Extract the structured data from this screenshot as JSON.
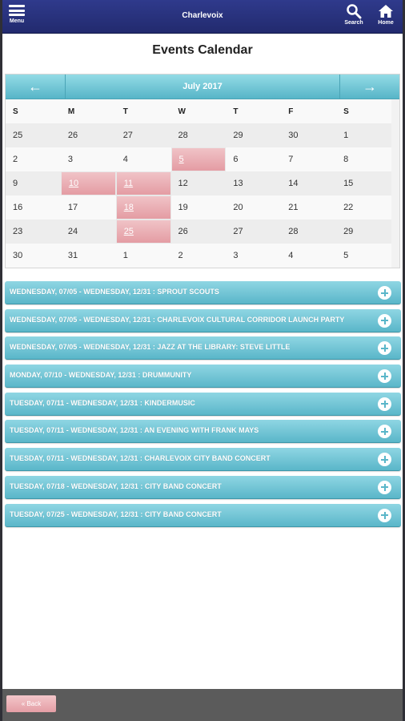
{
  "header": {
    "title": "Charlevoix",
    "menu_label": "Menu",
    "search_label": "Search",
    "home_label": "Home"
  },
  "page": {
    "title": "Events Calendar"
  },
  "calendar": {
    "month_label": "July 2017",
    "prev_icon": "←",
    "next_icon": "→",
    "days_of_week": [
      "S",
      "M",
      "T",
      "W",
      "T",
      "F",
      "S"
    ],
    "weeks": [
      [
        "25",
        "26",
        "27",
        "28",
        "29",
        "30",
        "1"
      ],
      [
        "2",
        "3",
        "4",
        "5",
        "6",
        "7",
        "8"
      ],
      [
        "9",
        "10",
        "11",
        "12",
        "13",
        "14",
        "15"
      ],
      [
        "16",
        "17",
        "18",
        "19",
        "20",
        "21",
        "22"
      ],
      [
        "23",
        "24",
        "25",
        "26",
        "27",
        "28",
        "29"
      ],
      [
        "30",
        "31",
        "1",
        "2",
        "3",
        "4",
        "5"
      ]
    ],
    "event_color": "#e49ca3"
  },
  "events": [
    "WEDNESDAY, 07/05 - WEDNESDAY, 12/31 : SPROUT SCOUTS",
    "WEDNESDAY, 07/05 - WEDNESDAY, 12/31 : CHARLEVOIX CULTURAL CORRIDOR LAUNCH PARTY",
    "WEDNESDAY, 07/05 - WEDNESDAY, 12/31 : JAZZ AT THE LIBRARY: STEVE LITTLE",
    "MONDAY, 07/10 - WEDNESDAY, 12/31 : DRUMMUNITY",
    "TUESDAY, 07/11 - WEDNESDAY, 12/31 : KINDERMUSIC",
    "TUESDAY, 07/11 - WEDNESDAY, 12/31 : AN EVENING WITH FRANK MAYS",
    "TUESDAY, 07/11 - WEDNESDAY, 12/31 : CHARLEVOIX CITY BAND CONCERT",
    "TUESDAY, 07/18 - WEDNESDAY, 12/31 : CITY BAND CONCERT",
    "TUESDAY, 07/25 - WEDNESDAY, 12/31 : CITY BAND CONCERT"
  ],
  "footer": {
    "back_label": "« Back"
  },
  "colors": {
    "header": "#27307a",
    "accent": "#5ab6c9",
    "footer": "#5b5b5b"
  }
}
